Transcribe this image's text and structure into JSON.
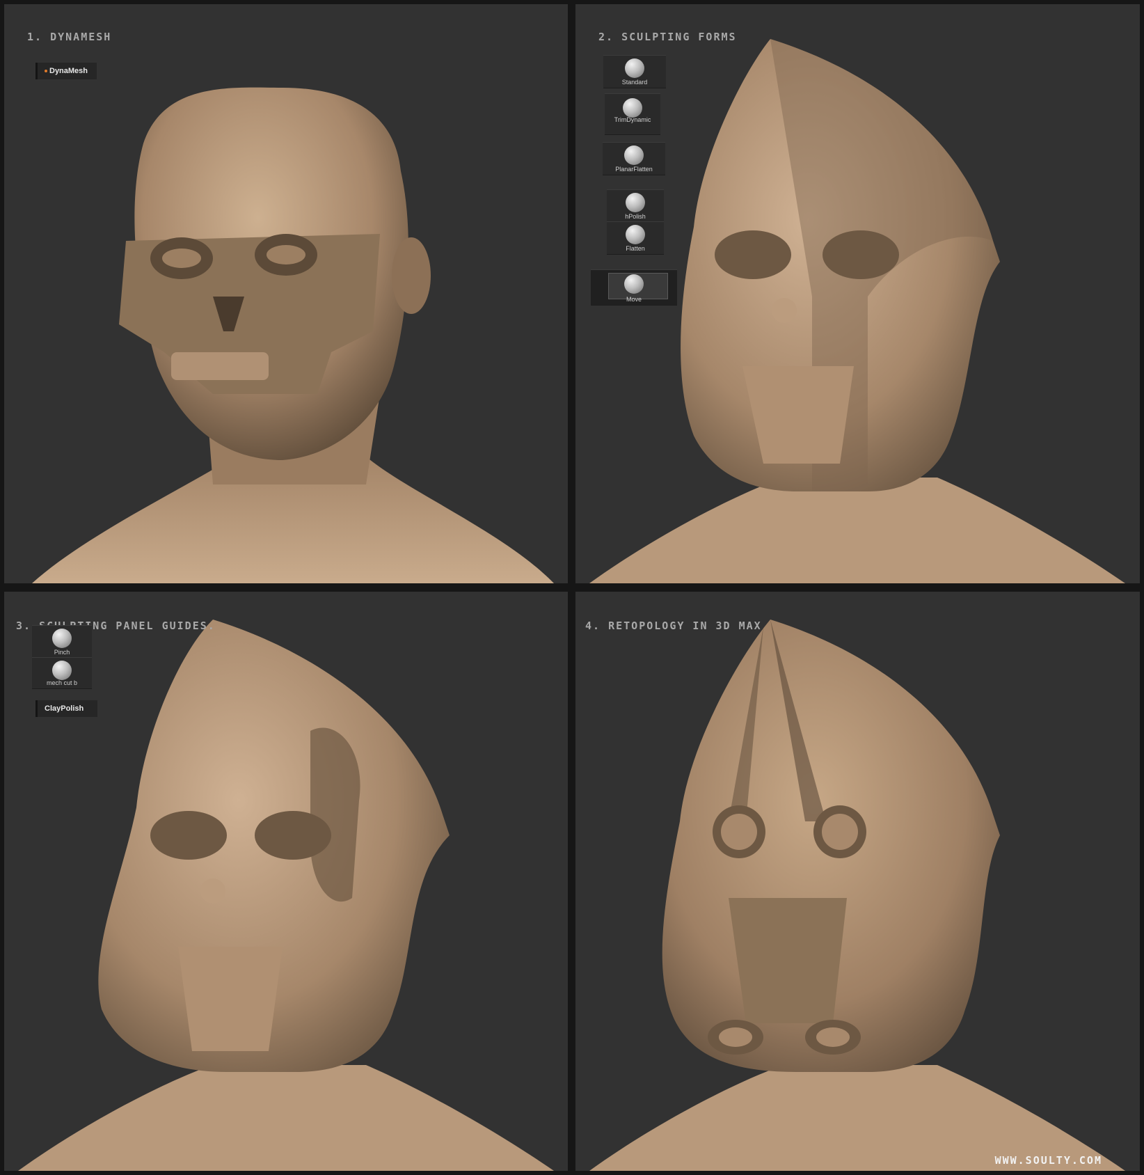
{
  "panels": [
    {
      "title": "1. DYNAMESH"
    },
    {
      "title": "2. SCULPTING FORMS"
    },
    {
      "title": "3. SCULPTING PANEL GUIDES."
    },
    {
      "title": "4. RETOPOLOGY IN 3D MAX"
    }
  ],
  "tools": {
    "dynamesh": "DynaMesh",
    "standard": "Standard",
    "trimdynamic": "TrimDynamic",
    "planarflatten": "PlanarFlatten",
    "hpolish": "hPolish",
    "flatten": "Flatten",
    "move": "Move",
    "pinch": "Pinch",
    "mechcut": "mech  cut  b",
    "claypolish": "ClayPolish"
  },
  "watermark": "WWW.SOULTY.COM",
  "colors": {
    "background": "#323232",
    "clay": "#b39273",
    "clay_shadow": "#6e5a44",
    "accent": "#e07a2a"
  }
}
